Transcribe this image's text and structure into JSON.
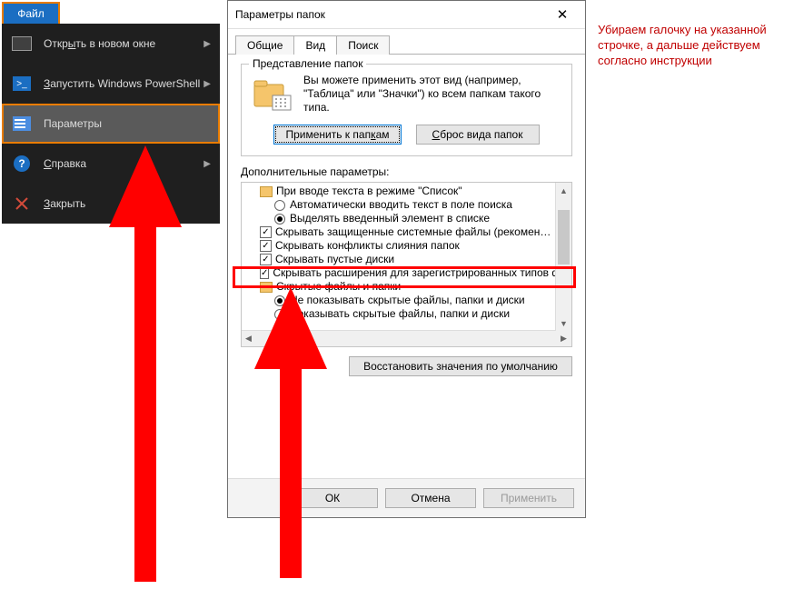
{
  "file_button": "Файл",
  "menu": {
    "open": "Открыть в новом окне",
    "open_mn": "ы",
    "ps": "Запустить Windows PowerShell",
    "ps_mn": "З",
    "params": "Параметры",
    "help": "Справка",
    "help_mn": "С",
    "close": "Закрыть",
    "close_mn": "З"
  },
  "dlg": {
    "title": "Параметры папок",
    "tabs": {
      "general": "Общие",
      "view": "Вид",
      "search": "Поиск"
    },
    "group_title": "Представление папок",
    "group_text": "Вы можете применить этот вид (например, \"Таблица\" или \"Значки\") ко всем папкам такого типа.",
    "apply_folders": "Применить к папкам",
    "apply_folders_mn": "к",
    "reset_folders": "Сброс вида папок",
    "reset_folders_mn": "С",
    "addl": "Дополнительные параметры:",
    "tree": {
      "n1": "При вводе текста в режиме \"Список\"",
      "n2": "Автоматически вводить текст в поле поиска",
      "n3": "Выделять введенный элемент в списке",
      "n4": "Скрывать защищенные системные файлы (рекомен…",
      "n5": "Скрывать конфликты слияния папок",
      "n6": "Скрывать пустые диски",
      "n7": "Скрывать расширения для зарегистрированных типов файлов",
      "n8": "Скрытые файлы и папки",
      "n9": "Не показывать скрытые файлы, папки и диски",
      "n10": "Показывать скрытые файлы, папки и диски"
    },
    "reset_defaults": "Восстановить значения по умолчанию",
    "ok": "ОК",
    "cancel": "Отмена",
    "apply": "Применить"
  },
  "note": "Убираем галочку на указанной строчке, а дальше действуем согласно инструкции"
}
